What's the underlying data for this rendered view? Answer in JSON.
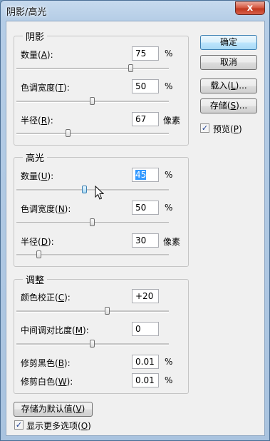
{
  "window": {
    "title": "阴影/高光",
    "close_symbol": "x"
  },
  "shadows": {
    "legend": "阴影",
    "amount": {
      "label": "数量(",
      "hotkey": "A",
      "suffix": "):",
      "value": "75",
      "unit": "%",
      "slider_level_percent": 75
    },
    "tonal_width": {
      "label": "色调宽度(",
      "hotkey": "T",
      "suffix": "):",
      "value": "50",
      "unit": "%",
      "slider_level_percent": 50
    },
    "radius": {
      "label": "半径(",
      "hotkey": "R",
      "suffix": "):",
      "value": "67",
      "unit": "像素",
      "slider_level_percent": 34
    }
  },
  "highlights": {
    "legend": "高光",
    "amount": {
      "label": "数量(",
      "hotkey": "U",
      "suffix": "):",
      "value": "45",
      "unit": "%",
      "slider_level_percent": 45
    },
    "tonal_width": {
      "label": "色调宽度(",
      "hotkey": "N",
      "suffix": "):",
      "value": "50",
      "unit": "%",
      "slider_level_percent": 50
    },
    "radius": {
      "label": "半径(",
      "hotkey": "D",
      "suffix": "):",
      "value": "30",
      "unit": "像素",
      "slider_level_percent": 15
    }
  },
  "adjustments": {
    "legend": "调整",
    "color_correction": {
      "label": "颜色校正(",
      "hotkey": "C",
      "suffix": "):",
      "value": "+20",
      "slider_level_percent": 60
    },
    "midtone_contrast": {
      "label": "中间调对比度(",
      "hotkey": "M",
      "suffix": "):",
      "value": "0",
      "slider_level_percent": 50
    },
    "black_clip": {
      "label": "修剪黑色(",
      "hotkey": "B",
      "suffix": "):",
      "value": "0.01",
      "unit": "%"
    },
    "white_clip": {
      "label": "修剪白色(",
      "hotkey": "W",
      "suffix": "):",
      "value": "0.01",
      "unit": "%"
    }
  },
  "buttons": {
    "ok": "确定",
    "cancel": "取消",
    "load": {
      "label": "载入(",
      "hotkey": "L",
      "suffix": ")..."
    },
    "save": {
      "label": "存储(",
      "hotkey": "S",
      "suffix": ")..."
    },
    "save_defaults": {
      "label": "存储为默认值(",
      "hotkey": "V",
      "suffix": ")"
    }
  },
  "preview": {
    "label": "预览(",
    "hotkey": "P",
    "suffix": ")",
    "checked": true
  },
  "more_options": {
    "label": "显示更多选项(",
    "hotkey": "O",
    "suffix": ")",
    "checked": true
  },
  "icons": {
    "checkmark": "✓",
    "cursor": "arrow-cursor-icon"
  }
}
